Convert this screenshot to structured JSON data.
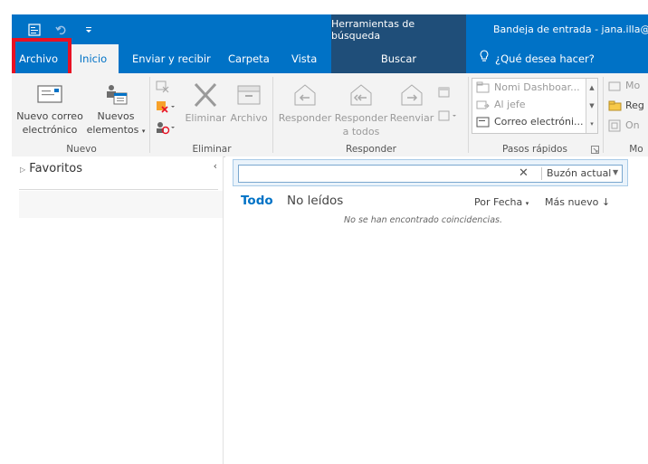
{
  "titlebar": {
    "qat_icons": [
      "send-receive-icon",
      "undo-icon",
      "customize-qat-icon"
    ],
    "contextual_group": "Herramientas de búsqueda",
    "window_title": "Bandeja de entrada - jana.illa@"
  },
  "tabs": {
    "archivo": "Archivo",
    "inicio": "Inicio",
    "enviar_recibir": "Enviar y recibir",
    "carpeta": "Carpeta",
    "vista": "Vista",
    "buscar": "Buscar",
    "tell_me": "¿Qué desea hacer?"
  },
  "ribbon": {
    "nuevo": {
      "new_email_line1": "Nuevo correo",
      "new_email_line2": "electrónico",
      "new_items_line1": "Nuevos",
      "new_items_line2": "elementos",
      "group_label": "Nuevo"
    },
    "eliminar": {
      "delete": "Eliminar",
      "archive": "Archivo",
      "group_label": "Eliminar"
    },
    "responder": {
      "reply": "Responder",
      "reply_all_line1": "Responder",
      "reply_all_line2": "a todos",
      "forward": "Reenviar",
      "group_label": "Responder"
    },
    "pasos_rapidos": {
      "items": [
        "Nomi Dashboar...",
        "Al jefe",
        "Correo electróni..."
      ],
      "group_label": "Pasos rápidos"
    },
    "mover": {
      "items": [
        "Mo",
        "Reg",
        "On"
      ],
      "group_label": "Mo"
    }
  },
  "folder_pane": {
    "favorites": "Favoritos",
    "collapse": "‹"
  },
  "search": {
    "placeholder": "",
    "clear": "✕",
    "scope": "Buzón actual"
  },
  "message_list": {
    "filter_all": "Todo",
    "filter_unread": "No leídos",
    "sort_by": "Por Fecha",
    "sort_order": "Más nuevo",
    "empty_message": "No se han encontrado coincidencias."
  },
  "colors": {
    "accent": "#0072c6",
    "contextual": "#1f4e79",
    "highlight": "#e81123"
  }
}
